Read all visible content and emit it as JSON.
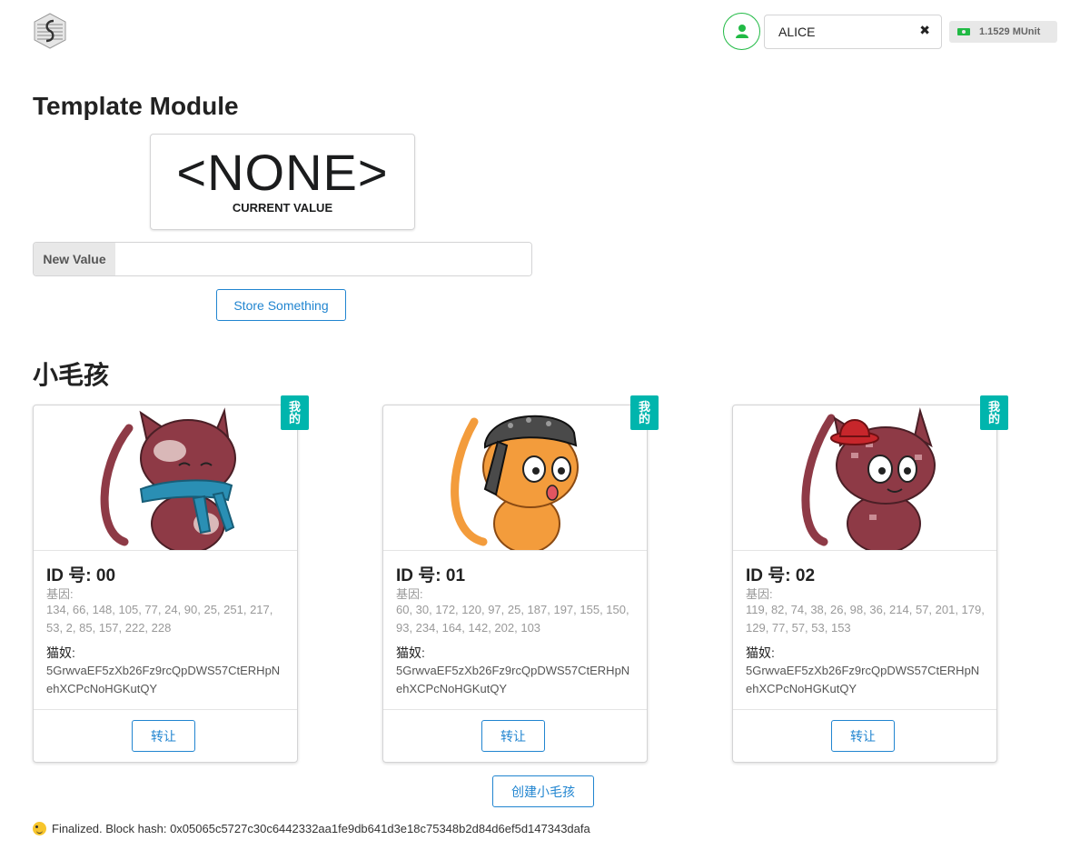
{
  "header": {
    "account": "ALICE",
    "clear_glyph": "✖",
    "balance": "1.1529 MUnit",
    "logo_icon": "substrate-logo-icon",
    "user_icon": "user-icon",
    "accent": "#21ba45"
  },
  "template": {
    "title": "Template Module",
    "current_value": "<NONE>",
    "current_caption": "CURRENT VALUE",
    "new_value_label": "New Value",
    "new_value_input": "",
    "store_button": "Store Something"
  },
  "kitties": {
    "title": "小毛孩",
    "mine_tag": [
      "我",
      "的"
    ],
    "genes_label": "基因:",
    "owner_label": "猫奴:",
    "transfer_button": "转让",
    "create_button": "创建小毛孩",
    "tag_color": "#00b5ad",
    "items": [
      {
        "id": "ID 号: 00",
        "genes": "134, 66, 148, 105, 77, 24, 90, 25, 251, 217, 53, 2, 85, 157, 222, 228",
        "owner": "5GrwvaEF5zXb26Fz9rcQpDWS57CtERHpNehXCPcNoHGKutQY",
        "image": "maroon cat with blue scarf"
      },
      {
        "id": "ID 号: 01",
        "genes": "60, 30, 172, 120, 97, 25, 187, 197, 155, 150, 93, 234, 164, 142, 202, 103",
        "owner": "5GrwvaEF5zXb26Fz9rcQpDWS57CtERHpNehXCPcNoHGKutQY",
        "image": "orange cat with bandana"
      },
      {
        "id": "ID 号: 02",
        "genes": "119, 82, 74, 38, 26, 98, 36, 214, 57, 201, 179, 129, 77, 57, 53, 153",
        "owner": "5GrwvaEF5zXb26Fz9rcQpDWS57CtERHpNehXCPcNoHGKutQY",
        "image": "maroon cat with red hat"
      }
    ]
  },
  "status": {
    "text": "Finalized. Block hash: 0x05065c5727c30c6442332aa1fe9db641d3e18c75348b2d84d6ef5d147343dafa",
    "icon": "wink-emoji-icon"
  }
}
